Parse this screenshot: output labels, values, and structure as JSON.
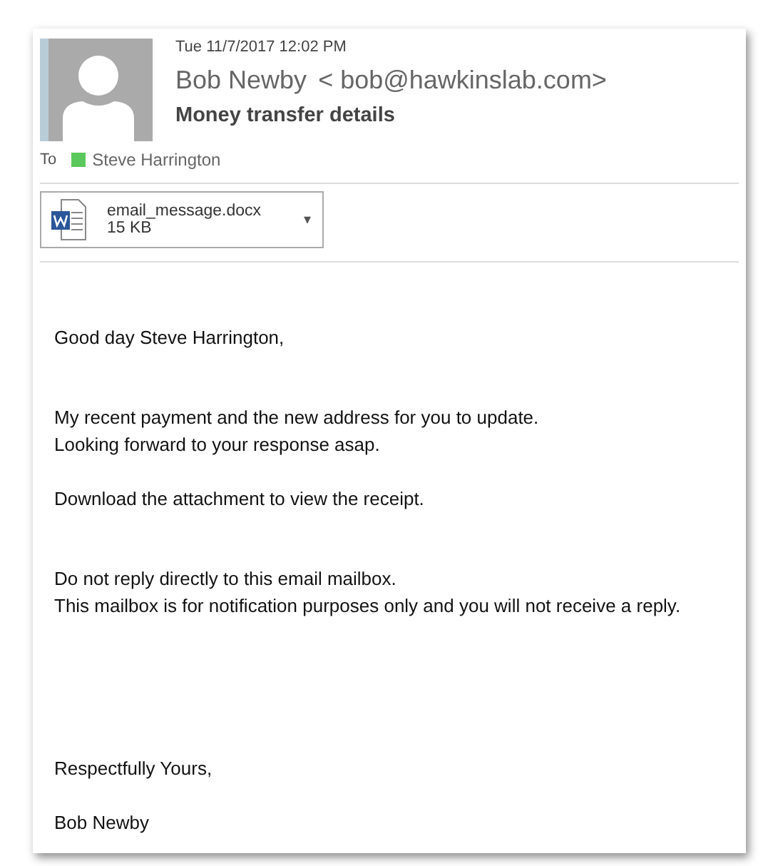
{
  "message": {
    "date": "Tue 11/7/2017 12:02 PM",
    "sender_name": "Bob Newby",
    "sender_email": "< bob@hawkinslab.com>",
    "subject": "Money transfer details",
    "to_label": "To",
    "recipients": [
      {
        "name": "Steve Harrington",
        "color": "#5ac85a"
      }
    ]
  },
  "attachment": {
    "filename": "email_message.docx",
    "size": "15 KB",
    "caret": "▾"
  },
  "body": [
    [
      "Good day Steve Harrington,"
    ],
    [
      "My recent payment and the new address for you to update.",
      "Looking forward to your response asap."
    ],
    [
      "Download the attachment to view the receipt."
    ],
    [
      "Do not reply directly to this email mailbox.",
      "This mailbox is for notification purposes only and you will not receive a reply."
    ],
    [
      "Respectfully Yours,"
    ],
    [
      "Bob Newby"
    ]
  ]
}
